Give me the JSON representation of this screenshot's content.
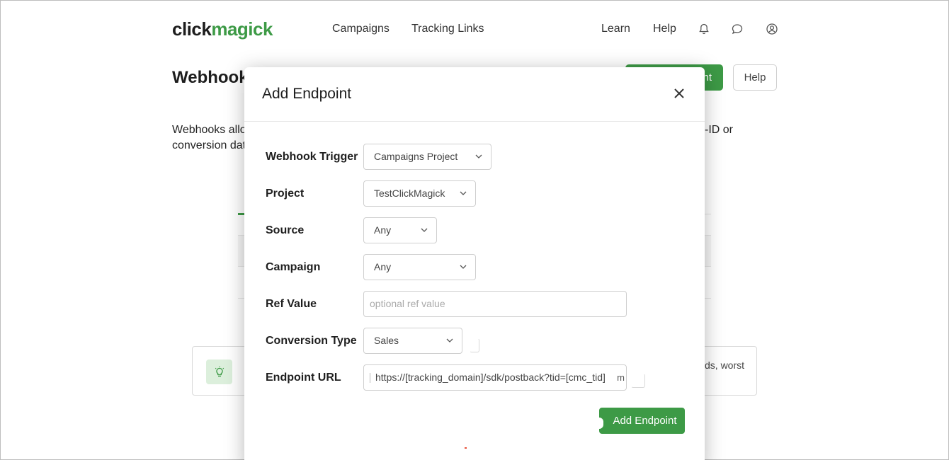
{
  "header": {
    "logo": {
      "click": "click",
      "magick": "magick"
    },
    "nav": {
      "campaigns": "Campaigns",
      "tracking_links": "Tracking Links",
      "learn": "Learn",
      "help": "Help"
    }
  },
  "page": {
    "title": "Webhook",
    "add_button_fragment": "nt",
    "help_button": "Help",
    "intro_line1_fragment": "Webhooks allo",
    "intro_line2_fragment": "conversion dat",
    "intro_right_fragment": "-ID or",
    "tip_right_line1": "ds, worst"
  },
  "modal": {
    "title": "Add Endpoint",
    "fields": {
      "webhook_trigger": {
        "label": "Webhook Trigger",
        "value": "Campaigns Project"
      },
      "project": {
        "label": "Project",
        "value": "TestClickMagick"
      },
      "source": {
        "label": "Source",
        "value": "Any"
      },
      "campaign": {
        "label": "Campaign",
        "value": "Any"
      },
      "ref_value": {
        "label": "Ref Value",
        "placeholder": "optional ref value"
      },
      "conversion_type": {
        "label": "Conversion Type",
        "value": "Sales"
      },
      "endpoint_url": {
        "label": "Endpoint URL",
        "value": "https://[tracking_domain]/sdk/postback?tid=[cmc_tid]",
        "tail": "m"
      }
    },
    "submit_label": "Add Endpoint"
  },
  "colors": {
    "accent": "#3d9a46",
    "tip_bg": "#dcefdc"
  }
}
